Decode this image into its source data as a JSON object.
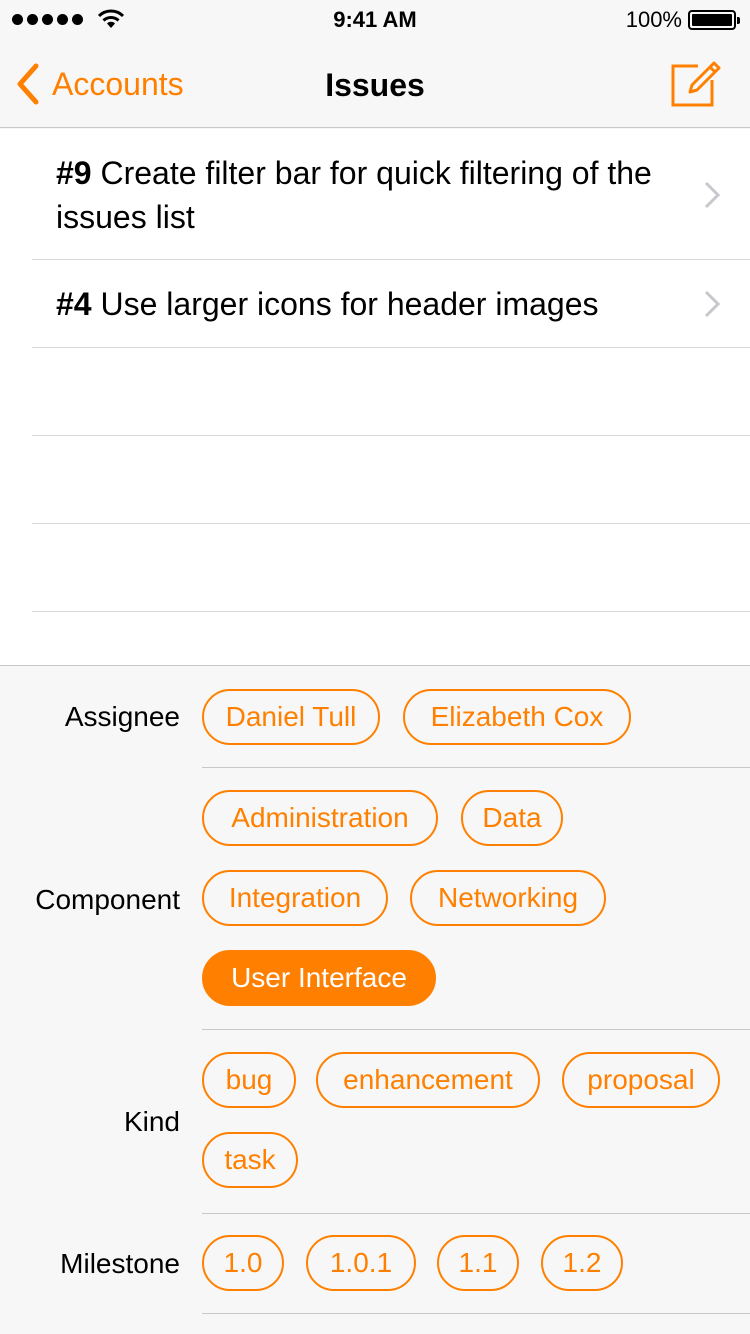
{
  "status_bar": {
    "time": "9:41 AM",
    "battery": "100%"
  },
  "nav": {
    "back_label": "Accounts",
    "title": "Issues",
    "compose_icon": "compose-icon"
  },
  "issues": [
    {
      "number": "#9",
      "title": "Create filter bar for quick filtering of the issues list"
    },
    {
      "number": "#4",
      "title": "Use larger icons for header images"
    }
  ],
  "filters": {
    "assignee": {
      "label": "Assignee",
      "options": [
        "Daniel Tull",
        "Elizabeth Cox"
      ]
    },
    "component": {
      "label": "Component",
      "options": [
        "Administration",
        "Data",
        "Integration",
        "Networking",
        "User Interface"
      ],
      "selected": "User Interface"
    },
    "kind": {
      "label": "Kind",
      "options": [
        "bug",
        "enhancement",
        "proposal",
        "task"
      ]
    },
    "milestone": {
      "label": "Milestone",
      "options": [
        "1.0",
        "1.0.1",
        "1.1",
        "1.2"
      ]
    }
  },
  "colors": {
    "accent": "#ff8000",
    "separator": "#c8c7cc",
    "panel_bg": "#f7f7f7"
  }
}
